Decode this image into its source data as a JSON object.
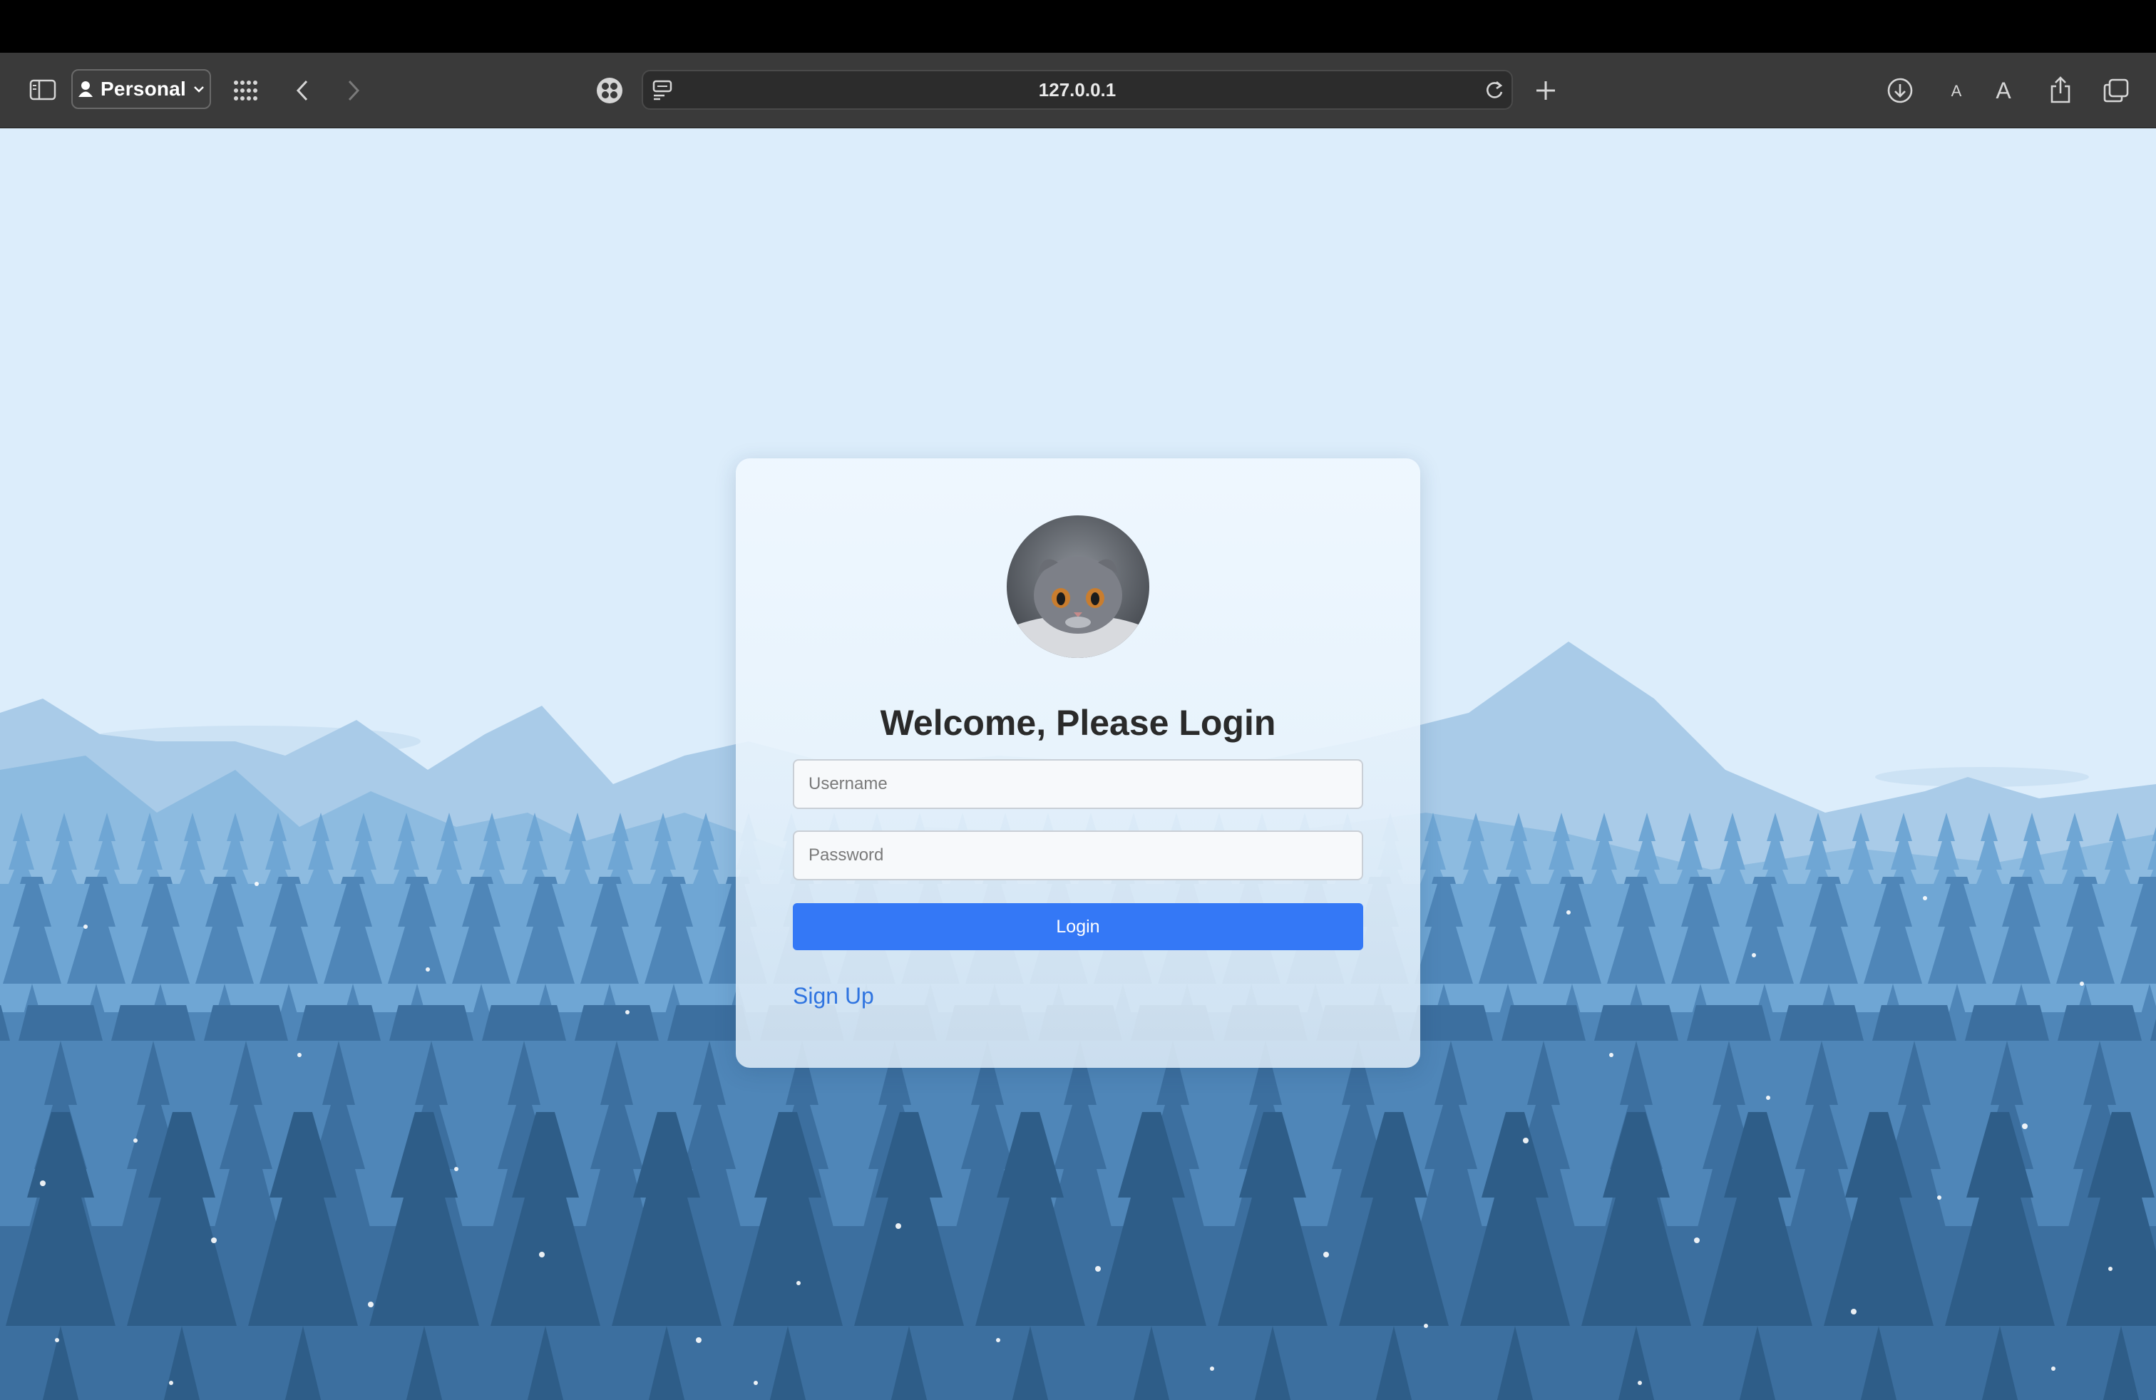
{
  "browser": {
    "profile_label": "Personal",
    "address": "127.0.0.1",
    "icons": [
      "sidebar-icon",
      "person-icon",
      "chevron-down-icon",
      "grid-icon",
      "back-icon",
      "forward-icon",
      "extension-icon",
      "reader-icon",
      "reload-icon",
      "plus-icon",
      "download-icon",
      "text-smaller-icon",
      "text-larger-icon",
      "share-icon",
      "tabs-icon"
    ]
  },
  "login": {
    "title": "Welcome, Please Login",
    "username_placeholder": "Username",
    "password_placeholder": "Password",
    "login_label": "Login",
    "signup_label": "Sign Up"
  },
  "colors": {
    "accent": "#3478f6",
    "link": "#2f74e0",
    "sky": "#dcedfb",
    "toolbar": "#3a3a3a"
  }
}
